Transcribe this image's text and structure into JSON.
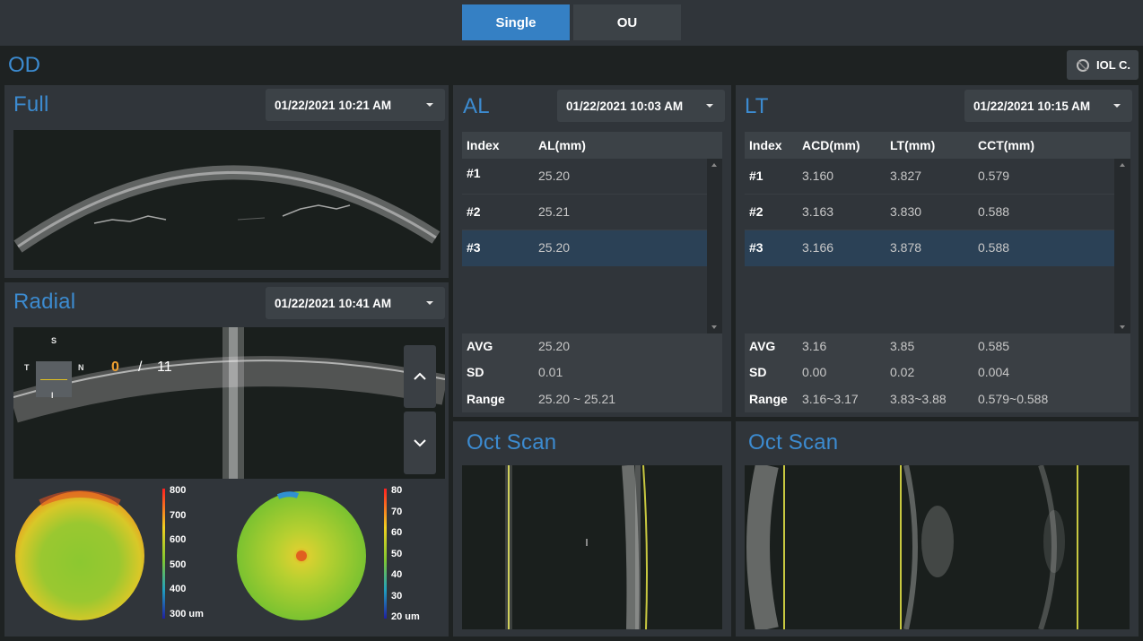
{
  "toolbar": {
    "single_label": "Single",
    "ou_label": "OU",
    "active": "Single"
  },
  "eye_label": "OD",
  "iol_button_label": "IOL C.",
  "full": {
    "title": "Full",
    "date": "01/22/2021 10:21 AM"
  },
  "radial": {
    "title": "Radial",
    "date": "01/22/2021 10:41 AM",
    "orient": {
      "top": "S",
      "bottom": "I",
      "left": "T",
      "right": "N"
    },
    "counter_current": "0",
    "counter_sep": "/",
    "counter_total": "11",
    "thickness_legend": [
      "800",
      "700",
      "600",
      "500",
      "400",
      "300 um"
    ],
    "epi_legend": [
      "80",
      "70",
      "60",
      "50",
      "40",
      "30",
      "20 um"
    ]
  },
  "al": {
    "title": "AL",
    "date": "01/22/2021 10:03 AM",
    "headers": [
      "Index",
      "AL(mm)"
    ],
    "rows": [
      [
        "#1",
        "25.20"
      ],
      [
        "#2",
        "25.21"
      ],
      [
        "#3",
        "25.20"
      ]
    ],
    "selected_row": 2,
    "stats": [
      {
        "label": "AVG",
        "values": [
          "25.20"
        ]
      },
      {
        "label": "SD",
        "values": [
          "0.01"
        ]
      },
      {
        "label": "Range",
        "values": [
          "25.20 ~ 25.21"
        ]
      }
    ]
  },
  "lt": {
    "title": "LT",
    "date": "01/22/2021 10:15 AM",
    "headers": [
      "Index",
      "ACD(mm)",
      "LT(mm)",
      "CCT(mm)"
    ],
    "rows": [
      [
        "#1",
        "3.160",
        "3.827",
        "0.579"
      ],
      [
        "#2",
        "3.163",
        "3.830",
        "0.588"
      ],
      [
        "#3",
        "3.166",
        "3.878",
        "0.588"
      ]
    ],
    "selected_row": 2,
    "stats": [
      {
        "label": "AVG",
        "values": [
          "3.16",
          "3.85",
          "0.585"
        ]
      },
      {
        "label": "SD",
        "values": [
          "0.00",
          "0.02",
          "0.004"
        ]
      },
      {
        "label": "Range",
        "values": [
          "3.16~3.17",
          "3.83~3.88",
          "0.579~0.588"
        ]
      }
    ]
  },
  "oct_al": {
    "title": "Oct Scan"
  },
  "oct_lt": {
    "title": "Oct Scan"
  },
  "colors": {
    "accent": "#3c8bd0",
    "active_button": "#3580c4",
    "selected_row": "#2b4156",
    "counter": "#f0a030",
    "scan_line": "#c8c840"
  }
}
